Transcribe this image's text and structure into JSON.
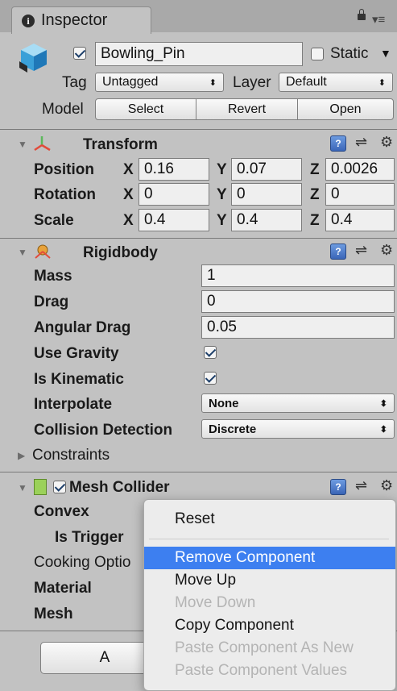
{
  "tab": {
    "title": "Inspector"
  },
  "object": {
    "name": "Bowling_Pin",
    "active": true,
    "static_label": "Static",
    "tag_label": "Tag",
    "tag_value": "Untagged",
    "layer_label": "Layer",
    "layer_value": "Default",
    "model_label": "Model",
    "model_buttons": [
      "Select",
      "Revert",
      "Open"
    ]
  },
  "transform": {
    "title": "Transform",
    "rows": [
      {
        "label": "Position",
        "x": "0.16",
        "y": "0.07",
        "z": "0.0026"
      },
      {
        "label": "Rotation",
        "x": "0",
        "y": "0",
        "z": "0"
      },
      {
        "label": "Scale",
        "x": "0.4",
        "y": "0.4",
        "z": "0.4"
      }
    ],
    "axis": {
      "x": "X",
      "y": "Y",
      "z": "Z"
    }
  },
  "rigidbody": {
    "title": "Rigidbody",
    "mass_label": "Mass",
    "mass": "1",
    "drag_label": "Drag",
    "drag": "0",
    "angular_drag_label": "Angular Drag",
    "angular_drag": "0.05",
    "use_gravity_label": "Use Gravity",
    "use_gravity": true,
    "is_kinematic_label": "Is Kinematic",
    "is_kinematic": true,
    "interpolate_label": "Interpolate",
    "interpolate": "None",
    "collision_label": "Collision Detection",
    "collision": "Discrete",
    "constraints_label": "Constraints"
  },
  "mesh_collider": {
    "title": "Mesh Collider",
    "enabled": true,
    "convex_label": "Convex",
    "is_trigger_label": "Is Trigger",
    "cooking_label": "Cooking Optio",
    "material_label": "Material",
    "mesh_label": "Mesh"
  },
  "add_component_partial": "A",
  "context_menu": {
    "reset": "Reset",
    "remove_component": "Remove Component",
    "move_up": "Move Up",
    "move_down": "Move Down",
    "copy_component": "Copy Component",
    "paste_as_new": "Paste Component As New",
    "paste_values": "Paste Component Values"
  },
  "colors": {
    "panel": "#c2c2c2",
    "menu_highlight": "#3d7ff0",
    "help_icon": "#4a78c8"
  }
}
